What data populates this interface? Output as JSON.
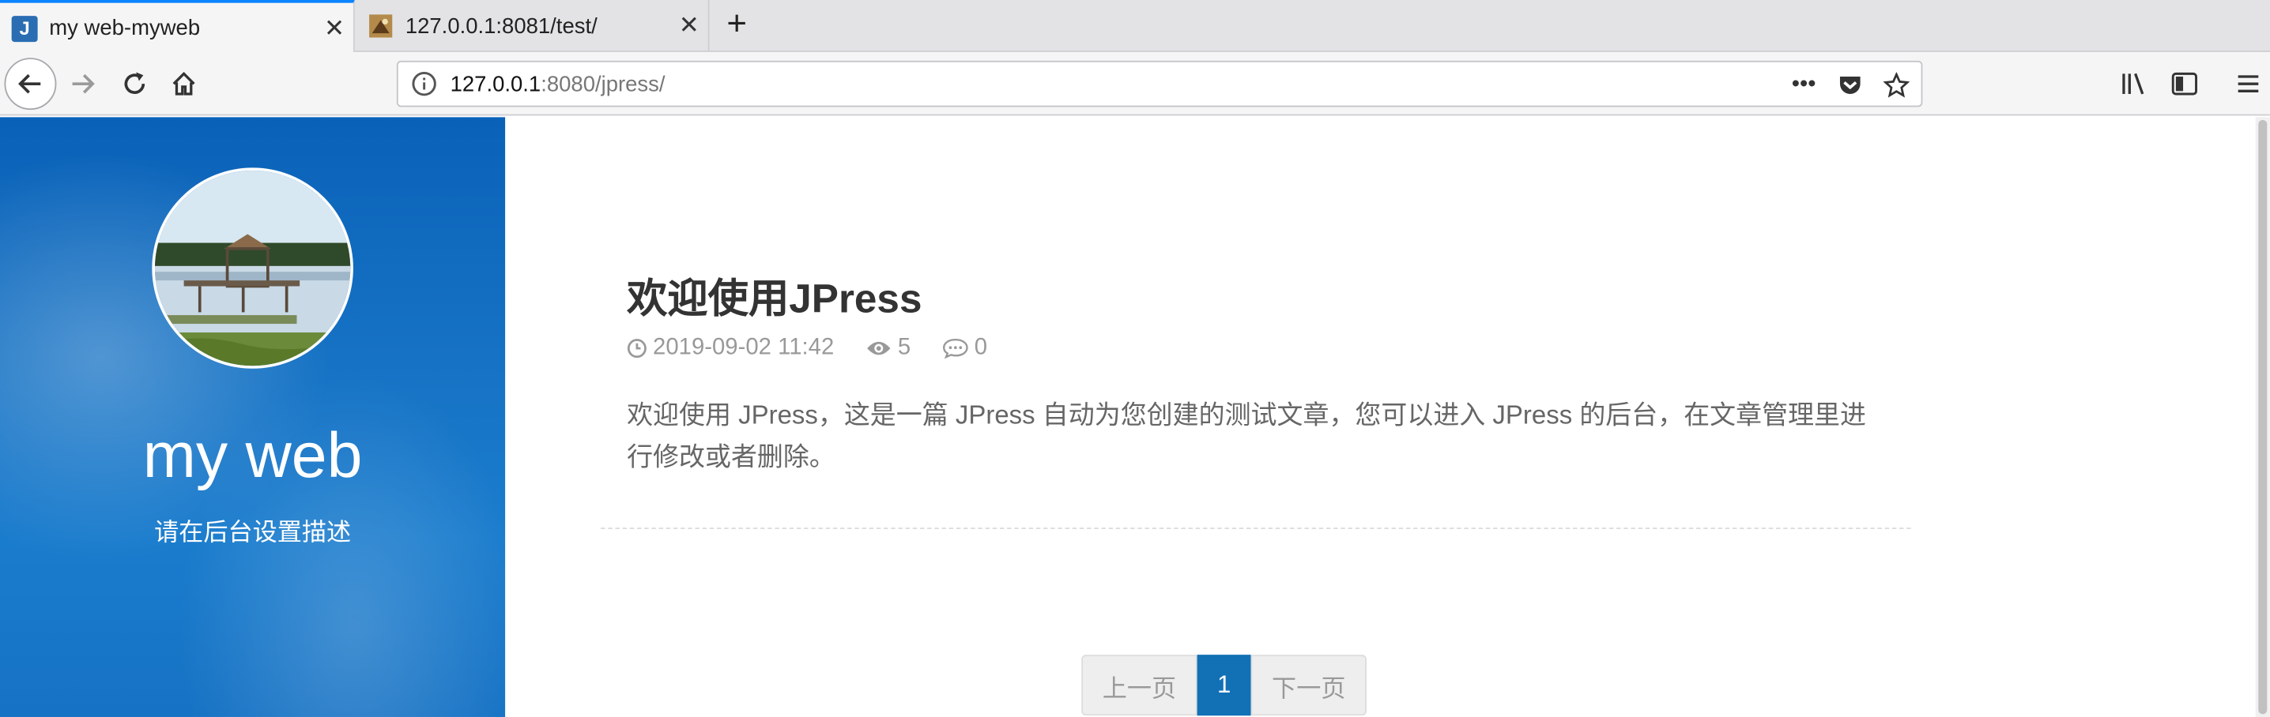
{
  "browser": {
    "tabs": [
      {
        "title": "my web-myweb",
        "favicon": "J"
      },
      {
        "title": "127.0.0.1:8081/test/",
        "favicon": "image-favicon"
      }
    ],
    "url_host": "127.0.0.1",
    "url_rest": ":8080/jpress/"
  },
  "sidebar": {
    "site_title": "my web",
    "site_description": "请在后台设置描述"
  },
  "post": {
    "title": "欢迎使用JPress",
    "date": "2019-09-02 11:42",
    "views": "5",
    "comments": "0",
    "excerpt": "欢迎使用 JPress，这是一篇 JPress 自动为您创建的测试文章，您可以进入 JPress 的后台，在文章管理里进行修改或者删除。"
  },
  "pagination": {
    "prev": "上一页",
    "current": "1",
    "next": "下一页"
  },
  "colors": {
    "accent": "#0a84ff",
    "sidebar_bg": "#1672c4",
    "pager_active": "#1270b5"
  }
}
